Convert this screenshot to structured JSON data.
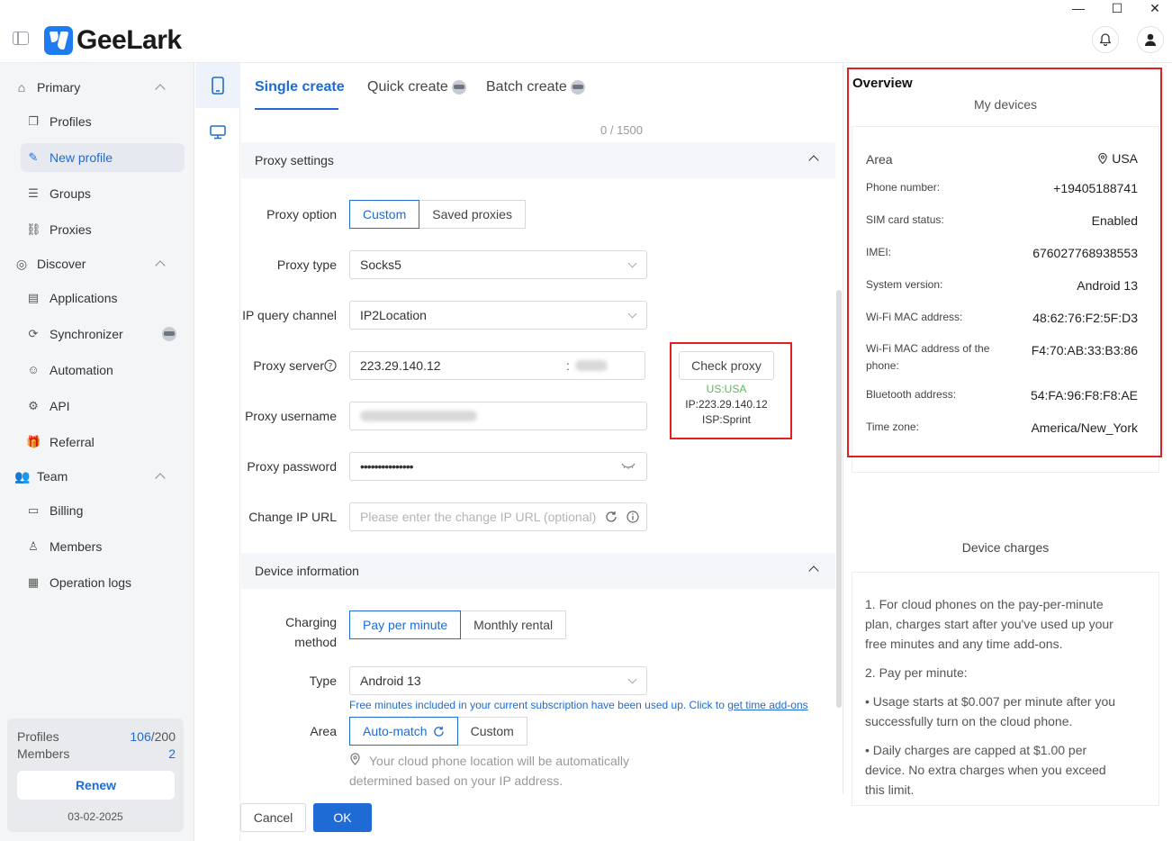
{
  "app": {
    "name": "GeeLark",
    "window_controls": {
      "minimize": "—",
      "maximize": "☐",
      "close": "✕"
    }
  },
  "nav": {
    "groups": [
      {
        "label": "Primary",
        "items": [
          {
            "label": "Profiles"
          },
          {
            "label": "New profile",
            "active": true
          },
          {
            "label": "Groups"
          },
          {
            "label": "Proxies"
          }
        ]
      },
      {
        "label": "Discover",
        "items": [
          {
            "label": "Applications"
          },
          {
            "label": "Synchronizer"
          },
          {
            "label": "Automation"
          },
          {
            "label": "API"
          },
          {
            "label": "Referral"
          }
        ]
      },
      {
        "label": "Team",
        "items": [
          {
            "label": "Billing"
          },
          {
            "label": "Members"
          },
          {
            "label": "Operation logs"
          }
        ]
      }
    ],
    "quota": {
      "profiles_label": "Profiles",
      "profiles_used": "106",
      "profiles_total": "/200",
      "members_label": "Members",
      "members_count": "2",
      "renew": "Renew",
      "date": "03-02-2025"
    }
  },
  "tabs": {
    "single": "Single create",
    "quick": "Quick create",
    "batch": "Batch create"
  },
  "counter": "0 / 1500",
  "proxy": {
    "section_title": "Proxy settings",
    "option_label": "Proxy option",
    "option_custom": "Custom",
    "option_saved": "Saved proxies",
    "type_label": "Proxy type",
    "type_value": "Socks5",
    "channel_label": "IP query channel",
    "channel_value": "IP2Location",
    "server_label": "Proxy server",
    "server_value": "223.29.140.12",
    "server_sep": ":",
    "username_label": "Proxy username",
    "password_label": "Proxy password",
    "password_value": "•••••••••••••••",
    "change_ip_label": "Change IP URL",
    "change_ip_placeholder": "Please enter the change IP URL (optional)",
    "check_button": "Check proxy",
    "result_country": "US:USA",
    "result_ip": "IP:223.29.140.12",
    "result_isp": "ISP:Sprint"
  },
  "device": {
    "section_title": "Device information",
    "charging_label_1": "Charging",
    "charging_label_2": "method",
    "charging_ppm": "Pay per minute",
    "charging_monthly": "Monthly rental",
    "type_label": "Type",
    "type_value": "Android 13",
    "free_minutes_hint": "Free minutes included in your current subscription have been used up. Click to ",
    "free_minutes_link": "get time add-ons",
    "area_label": "Area",
    "area_auto": "Auto-match",
    "area_custom": "Custom",
    "area_note": "Your cloud phone location will be automatically determined based on your IP address."
  },
  "footer": {
    "cancel": "Cancel",
    "ok": "OK"
  },
  "overview": {
    "title": "Overview",
    "subtitle": "My devices",
    "specs": [
      {
        "label": "Area",
        "value": "USA"
      },
      {
        "label": "Phone number:",
        "value": "+19405188741"
      },
      {
        "label": "SIM card status:",
        "value": "Enabled"
      },
      {
        "label": "IMEI:",
        "value": "676027768938553"
      },
      {
        "label": "System version:",
        "value": "Android 13"
      },
      {
        "label": "Wi-Fi MAC address:",
        "value": "48:62:76:F2:5F:D3"
      },
      {
        "label": "Wi-Fi MAC address of the phone:",
        "value": "F4:70:AB:33:B3:86"
      },
      {
        "label": "Bluetooth address:",
        "value": "54:FA:96:F8:F8:AE"
      },
      {
        "label": "Time zone:",
        "value": "America/New_York"
      }
    ],
    "charges_title": "Device charges",
    "charges": [
      "1. For cloud phones on the pay-per-minute plan, charges start after you've used up your free minutes and any time add-ons.",
      "2. Pay per minute:",
      "• Usage starts at $0.007 per minute after you successfully turn on the cloud phone.",
      "• Daily charges are capped at $1.00 per device. No extra charges when you exceed this limit."
    ]
  },
  "colors": {
    "accent": "#1e6bd6",
    "highlight_box": "#e02020",
    "proxy_ok": "#5cb85c"
  }
}
